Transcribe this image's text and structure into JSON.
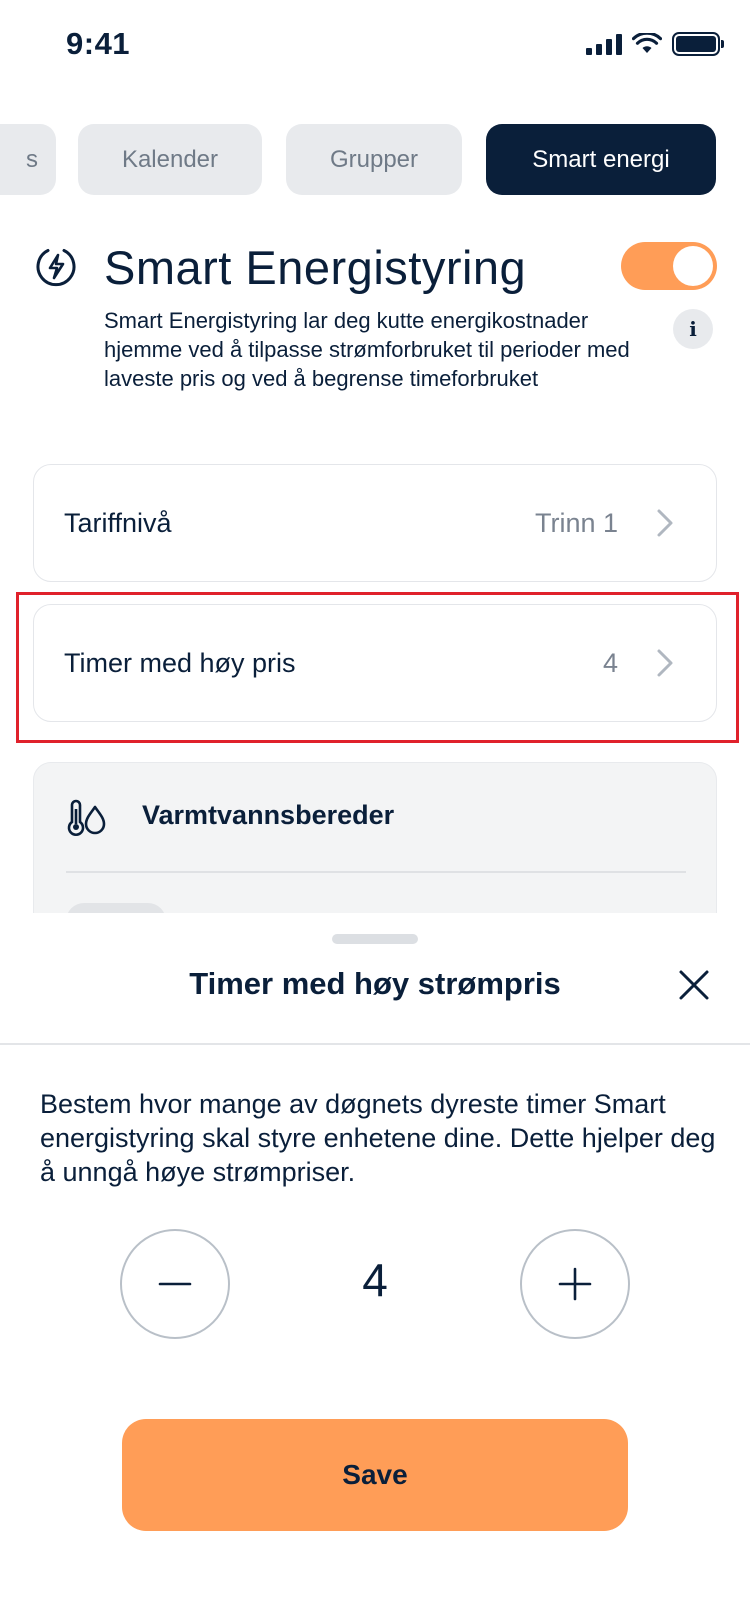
{
  "status_bar": {
    "time": "9:41"
  },
  "tabs": [
    {
      "label": "s",
      "active": false
    },
    {
      "label": "Kalender",
      "active": false
    },
    {
      "label": "Grupper",
      "active": false
    },
    {
      "label": "Smart energi",
      "active": true
    }
  ],
  "header": {
    "title": "Smart Energistyring",
    "description": "Smart Energistyring lar deg kutte energikostnader hjemme ved å tilpasse strømforbruket til perioder med laveste pris og ved å begrense timeforbruket",
    "toggle_on": true,
    "info_label": "i"
  },
  "rows": [
    {
      "label": "Tariffnivå",
      "value": "Trinn 1"
    },
    {
      "label": "Timer med høy pris",
      "value": "4"
    }
  ],
  "card": {
    "title": "Varmtvannsbereder"
  },
  "sheet": {
    "title": "Timer med høy strømpris",
    "description": "Bestem hvor mange av døgnets dyreste timer Smart energistyring skal styre enhetene dine. Dette hjelper deg å unngå høye strømpriser.",
    "value": "4",
    "save_label": "Save"
  },
  "colors": {
    "accent": "#ff9d57",
    "navy": "#0a1f3a",
    "highlight": "#e0212b"
  }
}
